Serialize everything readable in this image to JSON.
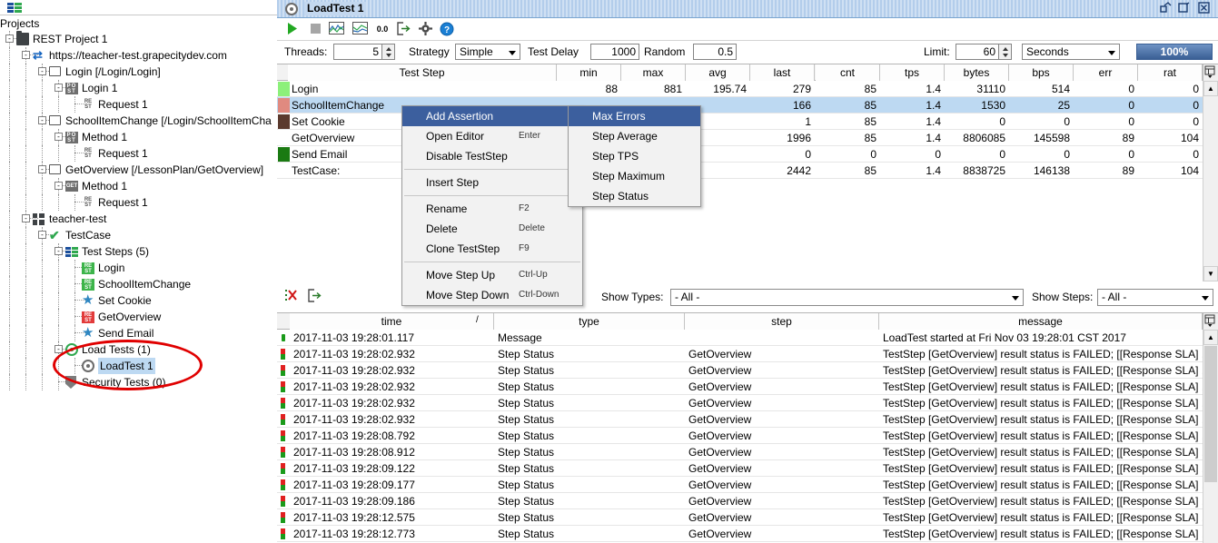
{
  "navigator": {
    "toolbar_icon": "test-steps-icon",
    "root_label": "Projects",
    "tree": [
      {
        "label": "REST Project 1",
        "depth": 0,
        "icon": "folder-icon",
        "expander": "-"
      },
      {
        "label": "https://teacher-test.grapecitydev.com",
        "depth": 1,
        "icon": "interface-icon",
        "expander": "-"
      },
      {
        "label": "Login [/Login/Login]",
        "depth": 2,
        "icon": "resource-icon",
        "expander": "-"
      },
      {
        "label": "Login 1",
        "depth": 3,
        "icon": "post-method-icon",
        "expander": "-"
      },
      {
        "label": "Request 1",
        "depth": 4,
        "icon": "rest-request-icon",
        "expander": ""
      },
      {
        "label": "SchoolItemChange [/Login/SchoolItemCha",
        "depth": 2,
        "icon": "resource-icon",
        "expander": "-"
      },
      {
        "label": "Method 1",
        "depth": 3,
        "icon": "post-method-icon",
        "expander": "-"
      },
      {
        "label": "Request 1",
        "depth": 4,
        "icon": "rest-request-icon",
        "expander": ""
      },
      {
        "label": "GetOverview [/LessonPlan/GetOverview]",
        "depth": 2,
        "icon": "resource-icon",
        "expander": "-"
      },
      {
        "label": "Method 1",
        "depth": 3,
        "icon": "get-method-icon",
        "expander": "-"
      },
      {
        "label": "Request 1",
        "depth": 4,
        "icon": "rest-request-icon",
        "expander": ""
      },
      {
        "label": "teacher-test",
        "depth": 1,
        "icon": "testsuite-icon",
        "expander": "-"
      },
      {
        "label": "TestCase",
        "depth": 2,
        "icon": "testcase-check-icon",
        "expander": "-"
      },
      {
        "label": "Test Steps (5)",
        "depth": 3,
        "icon": "test-steps-icon",
        "expander": "-"
      },
      {
        "label": "Login",
        "depth": 4,
        "icon": "rest-step-green-icon",
        "expander": ""
      },
      {
        "label": "SchoolItemChange",
        "depth": 4,
        "icon": "rest-step-green-icon",
        "expander": ""
      },
      {
        "label": "Set Cookie",
        "depth": 4,
        "icon": "star-icon",
        "expander": ""
      },
      {
        "label": "GetOverview",
        "depth": 4,
        "icon": "rest-step-red-icon",
        "expander": ""
      },
      {
        "label": "Send Email",
        "depth": 4,
        "icon": "star-icon",
        "expander": ""
      },
      {
        "label": "Load Tests (1)",
        "depth": 3,
        "icon": "load-test-green-icon",
        "expander": "-"
      },
      {
        "label": "LoadTest 1",
        "depth": 4,
        "icon": "load-test-icon",
        "expander": "",
        "selected": true
      },
      {
        "label": "Security Tests (0)",
        "depth": 3,
        "icon": "shield-icon",
        "expander": ""
      }
    ],
    "annotation": "red-ellipse-highlight"
  },
  "window": {
    "title": "LoadTest 1",
    "icon": "load-test-icon",
    "buttons": [
      {
        "name": "restore-window-button",
        "glyph": "❐"
      },
      {
        "name": "maximize-window-button",
        "glyph": "↗"
      },
      {
        "name": "close-window-button",
        "glyph": "✕"
      }
    ]
  },
  "toolbar": {
    "items": [
      {
        "name": "run-button",
        "glyph": "▶",
        "color": "#22a822"
      },
      {
        "name": "stop-button",
        "glyph": "■",
        "color": "#9e9e9e"
      },
      {
        "name": "statistics-chart-button",
        "glyph": "chart1",
        "color": "#4a7ebb"
      },
      {
        "name": "statistics-history-button",
        "glyph": "chart2",
        "color": "#4a7ebb"
      },
      {
        "name": "reset-statistics-button",
        "glyph": "0.0",
        "color": "#333333"
      },
      {
        "name": "export-statistics-button",
        "glyph": "export",
        "color": "#4a4a4a"
      },
      {
        "name": "options-button",
        "glyph": "gear",
        "color": "#4a4a4a"
      },
      {
        "name": "help-button",
        "glyph": "?",
        "color": "#1a7fd4"
      }
    ]
  },
  "options": {
    "threads_label": "Threads:",
    "threads_value": "5",
    "strategy_label": "Strategy",
    "strategy_value": "Simple",
    "test_delay_label": "Test Delay",
    "test_delay_value": "1000",
    "random_label": "Random",
    "random_value": "0.5",
    "limit_label": "Limit:",
    "limit_value": "60",
    "limit_unit": "Seconds",
    "progress_label": "100%",
    "accent_color": "#3a5f94"
  },
  "stats_table": {
    "columns": [
      "Test Step",
      "min",
      "max",
      "avg",
      "last",
      "cnt",
      "tps",
      "bytes",
      "bps",
      "err",
      "rat"
    ],
    "rows": [
      {
        "swatch": "#8cf07a",
        "cells": [
          "Login",
          "88",
          "881",
          "195.74",
          "279",
          "85",
          "1.4",
          "31110",
          "514",
          "0",
          "0"
        ]
      },
      {
        "swatch": "#e08a80",
        "selected": true,
        "cells": [
          "SchoolItemChange",
          "",
          "",
          "",
          "166",
          "85",
          "1.4",
          "1530",
          "25",
          "0",
          "0"
        ]
      },
      {
        "swatch": "#5b3a2e",
        "cells": [
          "Set Cookie",
          "",
          "",
          "",
          "1",
          "85",
          "1.4",
          "0",
          "0",
          "0",
          "0"
        ]
      },
      {
        "swatch": "",
        "cells": [
          "GetOverview",
          "",
          "",
          "",
          "1996",
          "85",
          "1.4",
          "8806085",
          "145598",
          "89",
          "104"
        ]
      },
      {
        "swatch": "#1a7a12",
        "cells": [
          "Send Email",
          "",
          "",
          "",
          "0",
          "0",
          "0",
          "0",
          "0",
          "0",
          "0"
        ]
      },
      {
        "swatch": "",
        "cells": [
          "TestCase:",
          "",
          "",
          "",
          "2442",
          "85",
          "1.4",
          "8838725",
          "146138",
          "89",
          "104"
        ]
      }
    ]
  },
  "context_menu": {
    "items": [
      {
        "label": "Add Assertion",
        "shortcut": "",
        "submenu": true,
        "highlighted": true
      },
      {
        "label": "Open Editor",
        "shortcut": "Enter",
        "submenu": false
      },
      {
        "label": "Disable TestStep",
        "shortcut": "",
        "submenu": false
      },
      {
        "separator": true
      },
      {
        "label": "Insert Step",
        "shortcut": "",
        "submenu": true
      },
      {
        "separator": true
      },
      {
        "label": "Rename",
        "shortcut": "F2",
        "submenu": false
      },
      {
        "label": "Delete",
        "shortcut": "Delete",
        "submenu": false
      },
      {
        "label": "Clone TestStep",
        "shortcut": "F9",
        "submenu": false
      },
      {
        "separator": true
      },
      {
        "label": "Move Step Up",
        "shortcut": "Ctrl-Up",
        "submenu": false
      },
      {
        "label": "Move Step Down",
        "shortcut": "Ctrl-Down",
        "submenu": false
      }
    ]
  },
  "submenu": {
    "items": [
      {
        "label": "Max Errors",
        "highlighted": true
      },
      {
        "label": "Step Average",
        "highlighted": false
      },
      {
        "label": "Step TPS",
        "highlighted": false
      },
      {
        "label": "Step Maximum",
        "highlighted": false
      },
      {
        "label": "Step Status",
        "highlighted": false
      }
    ]
  },
  "filters": {
    "clear_log_icon": "clear-log-icon",
    "export_log_icon": "export-log-icon",
    "show_types_label": "Show Types:",
    "show_types_value": "- All -",
    "show_steps_label": "Show Steps:",
    "show_steps_value": "- All -"
  },
  "log_table": {
    "columns": [
      "time",
      "type",
      "step",
      "message"
    ],
    "sort_column": "time",
    "rows": [
      {
        "icon": "info-icon",
        "time": "2017-11-03 19:28:01.117",
        "type": "Message",
        "step": "",
        "message": "LoadTest started at Fri Nov 03 19:28:01 CST 2017"
      },
      {
        "icon": "error-icon",
        "time": "2017-11-03 19:28:02.932",
        "type": "Step Status",
        "step": "GetOverview",
        "message": "TestStep [GetOverview] result status is FAILED; [[Response SLA] ..."
      },
      {
        "icon": "error-icon",
        "time": "2017-11-03 19:28:02.932",
        "type": "Step Status",
        "step": "GetOverview",
        "message": "TestStep [GetOverview] result status is FAILED; [[Response SLA] ..."
      },
      {
        "icon": "error-icon",
        "time": "2017-11-03 19:28:02.932",
        "type": "Step Status",
        "step": "GetOverview",
        "message": "TestStep [GetOverview] result status is FAILED; [[Response SLA] ..."
      },
      {
        "icon": "error-icon",
        "time": "2017-11-03 19:28:02.932",
        "type": "Step Status",
        "step": "GetOverview",
        "message": "TestStep [GetOverview] result status is FAILED; [[Response SLA] ..."
      },
      {
        "icon": "error-icon",
        "time": "2017-11-03 19:28:02.932",
        "type": "Step Status",
        "step": "GetOverview",
        "message": "TestStep [GetOverview] result status is FAILED; [[Response SLA] ..."
      },
      {
        "icon": "error-icon",
        "time": "2017-11-03 19:28:08.792",
        "type": "Step Status",
        "step": "GetOverview",
        "message": "TestStep [GetOverview] result status is FAILED; [[Response SLA] ..."
      },
      {
        "icon": "error-icon",
        "time": "2017-11-03 19:28:08.912",
        "type": "Step Status",
        "step": "GetOverview",
        "message": "TestStep [GetOverview] result status is FAILED; [[Response SLA] ..."
      },
      {
        "icon": "error-icon",
        "time": "2017-11-03 19:28:09.122",
        "type": "Step Status",
        "step": "GetOverview",
        "message": "TestStep [GetOverview] result status is FAILED; [[Response SLA] ..."
      },
      {
        "icon": "error-icon",
        "time": "2017-11-03 19:28:09.177",
        "type": "Step Status",
        "step": "GetOverview",
        "message": "TestStep [GetOverview] result status is FAILED; [[Response SLA] ..."
      },
      {
        "icon": "error-icon",
        "time": "2017-11-03 19:28:09.186",
        "type": "Step Status",
        "step": "GetOverview",
        "message": "TestStep [GetOverview] result status is FAILED; [[Response SLA] ..."
      },
      {
        "icon": "error-icon",
        "time": "2017-11-03 19:28:12.575",
        "type": "Step Status",
        "step": "GetOverview",
        "message": "TestStep [GetOverview] result status is FAILED; [[Response SLA] ..."
      },
      {
        "icon": "error-icon",
        "time": "2017-11-03 19:28:12.773",
        "type": "Step Status",
        "step": "GetOverview",
        "message": "TestStep [GetOverview] result status is FAILED; [[Response SLA] ..."
      }
    ]
  }
}
